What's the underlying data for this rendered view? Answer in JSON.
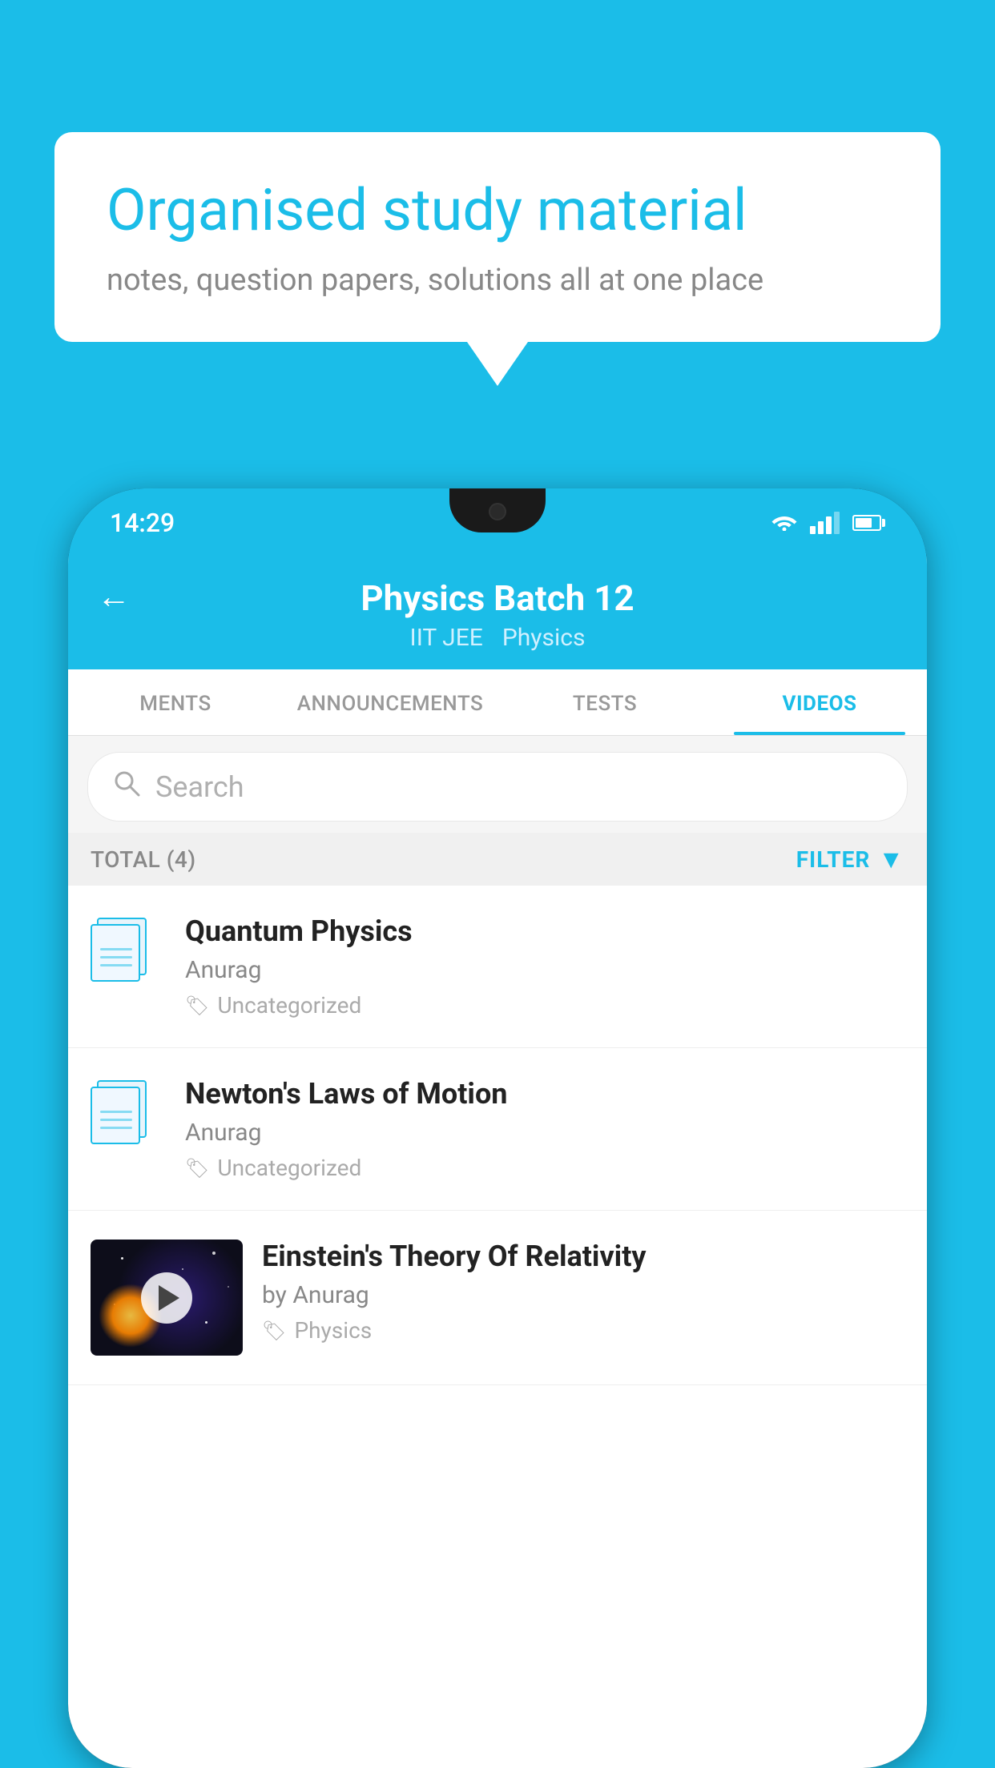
{
  "background_color": "#1BBDE8",
  "hero": {
    "title": "Organised study material",
    "subtitle": "notes, question papers, solutions all at one place"
  },
  "phone": {
    "status_bar": {
      "time": "14:29"
    },
    "app_header": {
      "back_label": "←",
      "title": "Physics Batch 12",
      "subtitle1": "IIT JEE",
      "subtitle2": "Physics"
    },
    "tabs": [
      {
        "label": "MENTS",
        "active": false
      },
      {
        "label": "ANNOUNCEMENTS",
        "active": false
      },
      {
        "label": "TESTS",
        "active": false
      },
      {
        "label": "VIDEOS",
        "active": true
      }
    ],
    "search": {
      "placeholder": "Search"
    },
    "filter": {
      "total_label": "TOTAL (4)",
      "filter_label": "FILTER"
    },
    "videos": [
      {
        "title": "Quantum Physics",
        "author": "Anurag",
        "tag": "Uncategorized",
        "has_thumbnail": false
      },
      {
        "title": "Newton's Laws of Motion",
        "author": "Anurag",
        "tag": "Uncategorized",
        "has_thumbnail": false
      },
      {
        "title": "Einstein's Theory Of Relativity",
        "author": "by Anurag",
        "tag": "Physics",
        "has_thumbnail": true
      }
    ]
  }
}
